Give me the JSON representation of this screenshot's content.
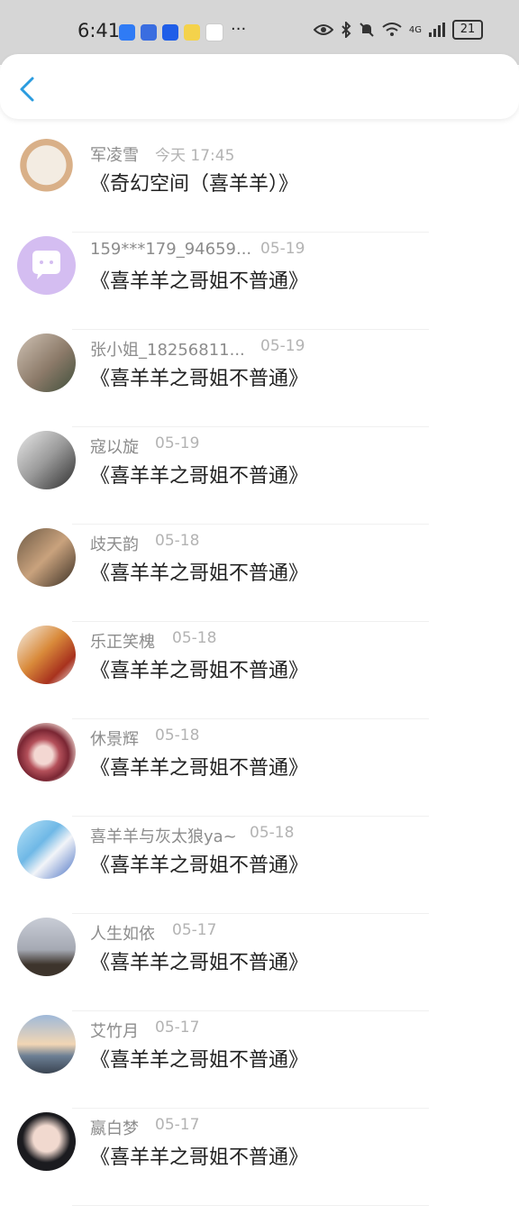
{
  "status_bar": {
    "time": "6:41",
    "more": "···",
    "network": "4G",
    "battery": "21"
  },
  "messages": [
    {
      "name": "军凌雪",
      "date": "今天 17:45",
      "text": "《奇幻空间（喜羊羊）》",
      "avatar": "anime-character"
    },
    {
      "name": "159***179_94659...",
      "date": "05-19",
      "text": "《喜羊羊之哥姐不普通》",
      "avatar": "chat-bubble"
    },
    {
      "name": "张小姐_18256811...",
      "date": "05-19",
      "text": "《喜羊羊之哥姐不普通》",
      "avatar": "photo"
    },
    {
      "name": "寇以旋",
      "date": "05-19",
      "text": "《喜羊羊之哥姐不普通》",
      "avatar": "photo"
    },
    {
      "name": "歧天韵",
      "date": "05-18",
      "text": "《喜羊羊之哥姐不普通》",
      "avatar": "photo"
    },
    {
      "name": "乐正笑槐",
      "date": "05-18",
      "text": "《喜羊羊之哥姐不普通》",
      "avatar": "food"
    },
    {
      "name": "休景辉",
      "date": "05-18",
      "text": "《喜羊羊之哥姐不普通》",
      "avatar": "lips"
    },
    {
      "name": "喜羊羊与灰太狼ya~",
      "date": "05-18",
      "text": "《喜羊羊之哥姐不普通》",
      "avatar": "anime-character"
    },
    {
      "name": "人生如依",
      "date": "05-17",
      "text": "《喜羊羊之哥姐不普通》",
      "avatar": "sky"
    },
    {
      "name": "艾竹月",
      "date": "05-17",
      "text": "《喜羊羊之哥姐不普通》",
      "avatar": "sunset"
    },
    {
      "name": "嬴白梦",
      "date": "05-17",
      "text": "《喜羊羊之哥姐不普通》",
      "avatar": "person"
    }
  ]
}
